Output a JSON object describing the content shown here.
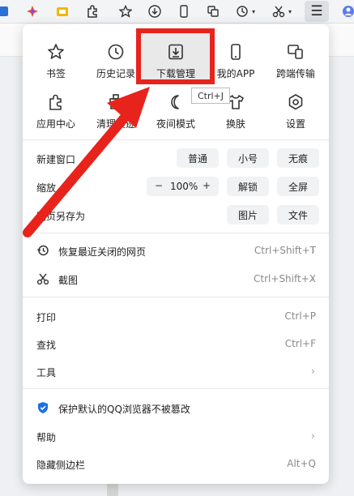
{
  "toolbar": {
    "icons": [
      "ext-translate-icon",
      "ext-star-sparkle-icon",
      "ext-folder-icon",
      "extensions-puzzle-icon",
      "bookmark-star-icon",
      "download-icon",
      "phone-icon",
      "copy-icon",
      "history-icon",
      "scissors-icon",
      "menu-icon",
      "profile-icon"
    ]
  },
  "grid": [
    {
      "label": "书签",
      "icon": "star-icon"
    },
    {
      "label": "历史记录",
      "icon": "clock-icon"
    },
    {
      "label": "下载管理",
      "icon": "download-tray-icon"
    },
    {
      "label": "我的APP",
      "icon": "phone-icon"
    },
    {
      "label": "跨端传输",
      "icon": "devices-icon"
    },
    {
      "label": "应用中心",
      "icon": "puzzle-icon"
    },
    {
      "label": "清理痕迹",
      "icon": "broom-icon"
    },
    {
      "label": "夜间模式",
      "icon": "moon-icon"
    },
    {
      "label": "换肤",
      "icon": "shirt-icon"
    },
    {
      "label": "设置",
      "icon": "gear-icon"
    }
  ],
  "tooltip": "Ctrl+J",
  "rows": {
    "new_window": {
      "label": "新建窗口",
      "opt1": "普通",
      "opt2": "小号",
      "opt3": "无痕"
    },
    "zoom": {
      "label": "缩放",
      "minus": "−",
      "value": "100%",
      "plus": "+",
      "opt1": "解锁",
      "opt2": "全屏"
    },
    "save_as": {
      "label": "网页另存为",
      "opt1": "图片",
      "opt2": "文件"
    },
    "restore": {
      "label": "恢复最近关闭的网页",
      "shortcut": "Ctrl+Shift+T"
    },
    "screenshot": {
      "label": "截图",
      "shortcut": "Ctrl+Shift+X"
    },
    "print": {
      "label": "打印",
      "shortcut": "Ctrl+P"
    },
    "find": {
      "label": "查找",
      "shortcut": "Ctrl+F"
    },
    "tools": {
      "label": "工具"
    },
    "protect": {
      "label": "保护默认的QQ浏览器不被篡改"
    },
    "help": {
      "label": "帮助"
    },
    "hide_sidebar": {
      "label": "隐藏侧边栏",
      "shortcut": "Alt+Q"
    }
  },
  "colors": {
    "annotation_red": "#e8231c",
    "shield_blue": "#1e6fe6"
  }
}
